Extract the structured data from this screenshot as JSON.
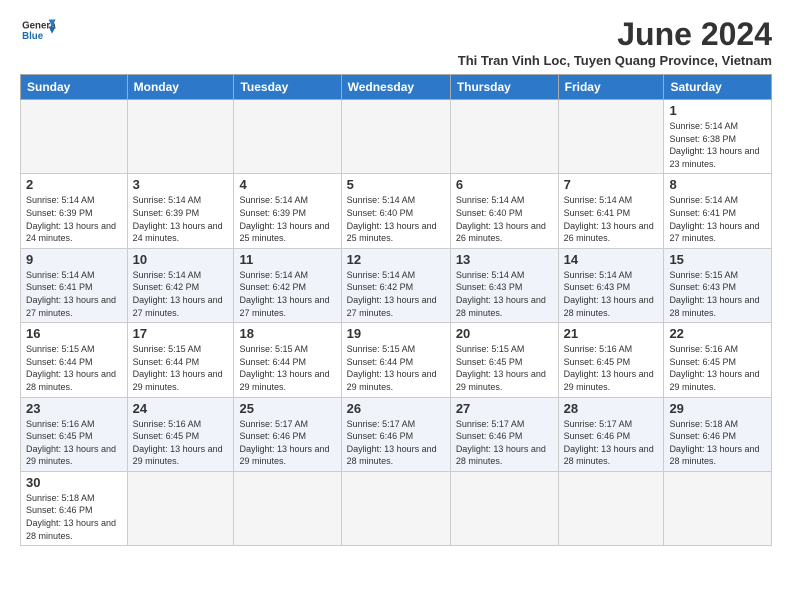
{
  "header": {
    "logo_line1": "General",
    "logo_line2": "Blue",
    "month": "June 2024",
    "location": "Thi Tran Vinh Loc, Tuyen Quang Province, Vietnam"
  },
  "weekdays": [
    "Sunday",
    "Monday",
    "Tuesday",
    "Wednesday",
    "Thursday",
    "Friday",
    "Saturday"
  ],
  "weeks": [
    [
      {
        "day": "",
        "info": ""
      },
      {
        "day": "",
        "info": ""
      },
      {
        "day": "",
        "info": ""
      },
      {
        "day": "",
        "info": ""
      },
      {
        "day": "",
        "info": ""
      },
      {
        "day": "",
        "info": ""
      },
      {
        "day": "1",
        "info": "Sunrise: 5:14 AM\nSunset: 6:38 PM\nDaylight: 13 hours and 23 minutes."
      }
    ],
    [
      {
        "day": "2",
        "info": "Sunrise: 5:14 AM\nSunset: 6:39 PM\nDaylight: 13 hours and 24 minutes."
      },
      {
        "day": "3",
        "info": "Sunrise: 5:14 AM\nSunset: 6:39 PM\nDaylight: 13 hours and 24 minutes."
      },
      {
        "day": "4",
        "info": "Sunrise: 5:14 AM\nSunset: 6:39 PM\nDaylight: 13 hours and 25 minutes."
      },
      {
        "day": "5",
        "info": "Sunrise: 5:14 AM\nSunset: 6:40 PM\nDaylight: 13 hours and 25 minutes."
      },
      {
        "day": "6",
        "info": "Sunrise: 5:14 AM\nSunset: 6:40 PM\nDaylight: 13 hours and 26 minutes."
      },
      {
        "day": "7",
        "info": "Sunrise: 5:14 AM\nSunset: 6:41 PM\nDaylight: 13 hours and 26 minutes."
      },
      {
        "day": "8",
        "info": "Sunrise: 5:14 AM\nSunset: 6:41 PM\nDaylight: 13 hours and 27 minutes."
      }
    ],
    [
      {
        "day": "9",
        "info": "Sunrise: 5:14 AM\nSunset: 6:41 PM\nDaylight: 13 hours and 27 minutes."
      },
      {
        "day": "10",
        "info": "Sunrise: 5:14 AM\nSunset: 6:42 PM\nDaylight: 13 hours and 27 minutes."
      },
      {
        "day": "11",
        "info": "Sunrise: 5:14 AM\nSunset: 6:42 PM\nDaylight: 13 hours and 27 minutes."
      },
      {
        "day": "12",
        "info": "Sunrise: 5:14 AM\nSunset: 6:42 PM\nDaylight: 13 hours and 27 minutes."
      },
      {
        "day": "13",
        "info": "Sunrise: 5:14 AM\nSunset: 6:43 PM\nDaylight: 13 hours and 28 minutes."
      },
      {
        "day": "14",
        "info": "Sunrise: 5:14 AM\nSunset: 6:43 PM\nDaylight: 13 hours and 28 minutes."
      },
      {
        "day": "15",
        "info": "Sunrise: 5:15 AM\nSunset: 6:43 PM\nDaylight: 13 hours and 28 minutes."
      }
    ],
    [
      {
        "day": "16",
        "info": "Sunrise: 5:15 AM\nSunset: 6:44 PM\nDaylight: 13 hours and 28 minutes."
      },
      {
        "day": "17",
        "info": "Sunrise: 5:15 AM\nSunset: 6:44 PM\nDaylight: 13 hours and 29 minutes."
      },
      {
        "day": "18",
        "info": "Sunrise: 5:15 AM\nSunset: 6:44 PM\nDaylight: 13 hours and 29 minutes."
      },
      {
        "day": "19",
        "info": "Sunrise: 5:15 AM\nSunset: 6:44 PM\nDaylight: 13 hours and 29 minutes."
      },
      {
        "day": "20",
        "info": "Sunrise: 5:15 AM\nSunset: 6:45 PM\nDaylight: 13 hours and 29 minutes."
      },
      {
        "day": "21",
        "info": "Sunrise: 5:16 AM\nSunset: 6:45 PM\nDaylight: 13 hours and 29 minutes."
      },
      {
        "day": "22",
        "info": "Sunrise: 5:16 AM\nSunset: 6:45 PM\nDaylight: 13 hours and 29 minutes."
      }
    ],
    [
      {
        "day": "23",
        "info": "Sunrise: 5:16 AM\nSunset: 6:45 PM\nDaylight: 13 hours and 29 minutes."
      },
      {
        "day": "24",
        "info": "Sunrise: 5:16 AM\nSunset: 6:45 PM\nDaylight: 13 hours and 29 minutes."
      },
      {
        "day": "25",
        "info": "Sunrise: 5:17 AM\nSunset: 6:46 PM\nDaylight: 13 hours and 29 minutes."
      },
      {
        "day": "26",
        "info": "Sunrise: 5:17 AM\nSunset: 6:46 PM\nDaylight: 13 hours and 28 minutes."
      },
      {
        "day": "27",
        "info": "Sunrise: 5:17 AM\nSunset: 6:46 PM\nDaylight: 13 hours and 28 minutes."
      },
      {
        "day": "28",
        "info": "Sunrise: 5:17 AM\nSunset: 6:46 PM\nDaylight: 13 hours and 28 minutes."
      },
      {
        "day": "29",
        "info": "Sunrise: 5:18 AM\nSunset: 6:46 PM\nDaylight: 13 hours and 28 minutes."
      }
    ],
    [
      {
        "day": "30",
        "info": "Sunrise: 5:18 AM\nSunset: 6:46 PM\nDaylight: 13 hours and 28 minutes."
      },
      {
        "day": "",
        "info": ""
      },
      {
        "day": "",
        "info": ""
      },
      {
        "day": "",
        "info": ""
      },
      {
        "day": "",
        "info": ""
      },
      {
        "day": "",
        "info": ""
      },
      {
        "day": "",
        "info": ""
      }
    ]
  ]
}
